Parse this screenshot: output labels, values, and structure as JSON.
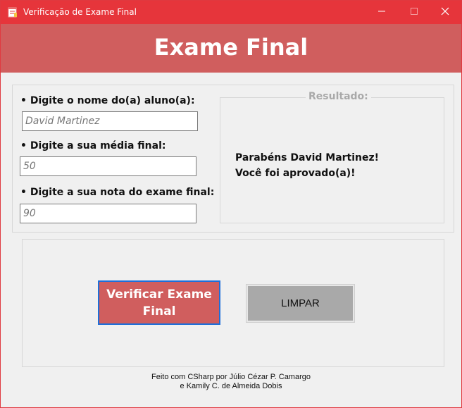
{
  "window": {
    "title": "Verificação de Exame Final"
  },
  "banner": {
    "title": "Exame Final"
  },
  "form": {
    "name_label": "• Digite o nome do(a) aluno(a):",
    "name_value": "David Martinez",
    "average_label": "• Digite a sua média final:",
    "average_value": "50",
    "exam_label": "• Digite a sua nota do exame final:",
    "exam_value": "90"
  },
  "result": {
    "legend": "Resultado:",
    "line1": "Parabéns David Martinez!",
    "line2": "Você foi aprovado(a)!"
  },
  "buttons": {
    "verify_label": "Verificar Exame Final",
    "clear_label": "LIMPAR"
  },
  "footer": {
    "line1": "Feito com CSharp por Júlio Cézar P. Camargo",
    "line2": "e Kamily C. de Almeida Dobis"
  },
  "colors": {
    "titlebar": "#e6353b",
    "banner": "#d05e5e",
    "verify_button": "#d05e5e",
    "clear_button": "#a9a9a9",
    "focus_border": "#1e6fd9"
  },
  "icons": {
    "app": "notepad-icon",
    "minimize": "minimize-icon",
    "maximize": "maximize-icon",
    "close": "close-icon"
  }
}
